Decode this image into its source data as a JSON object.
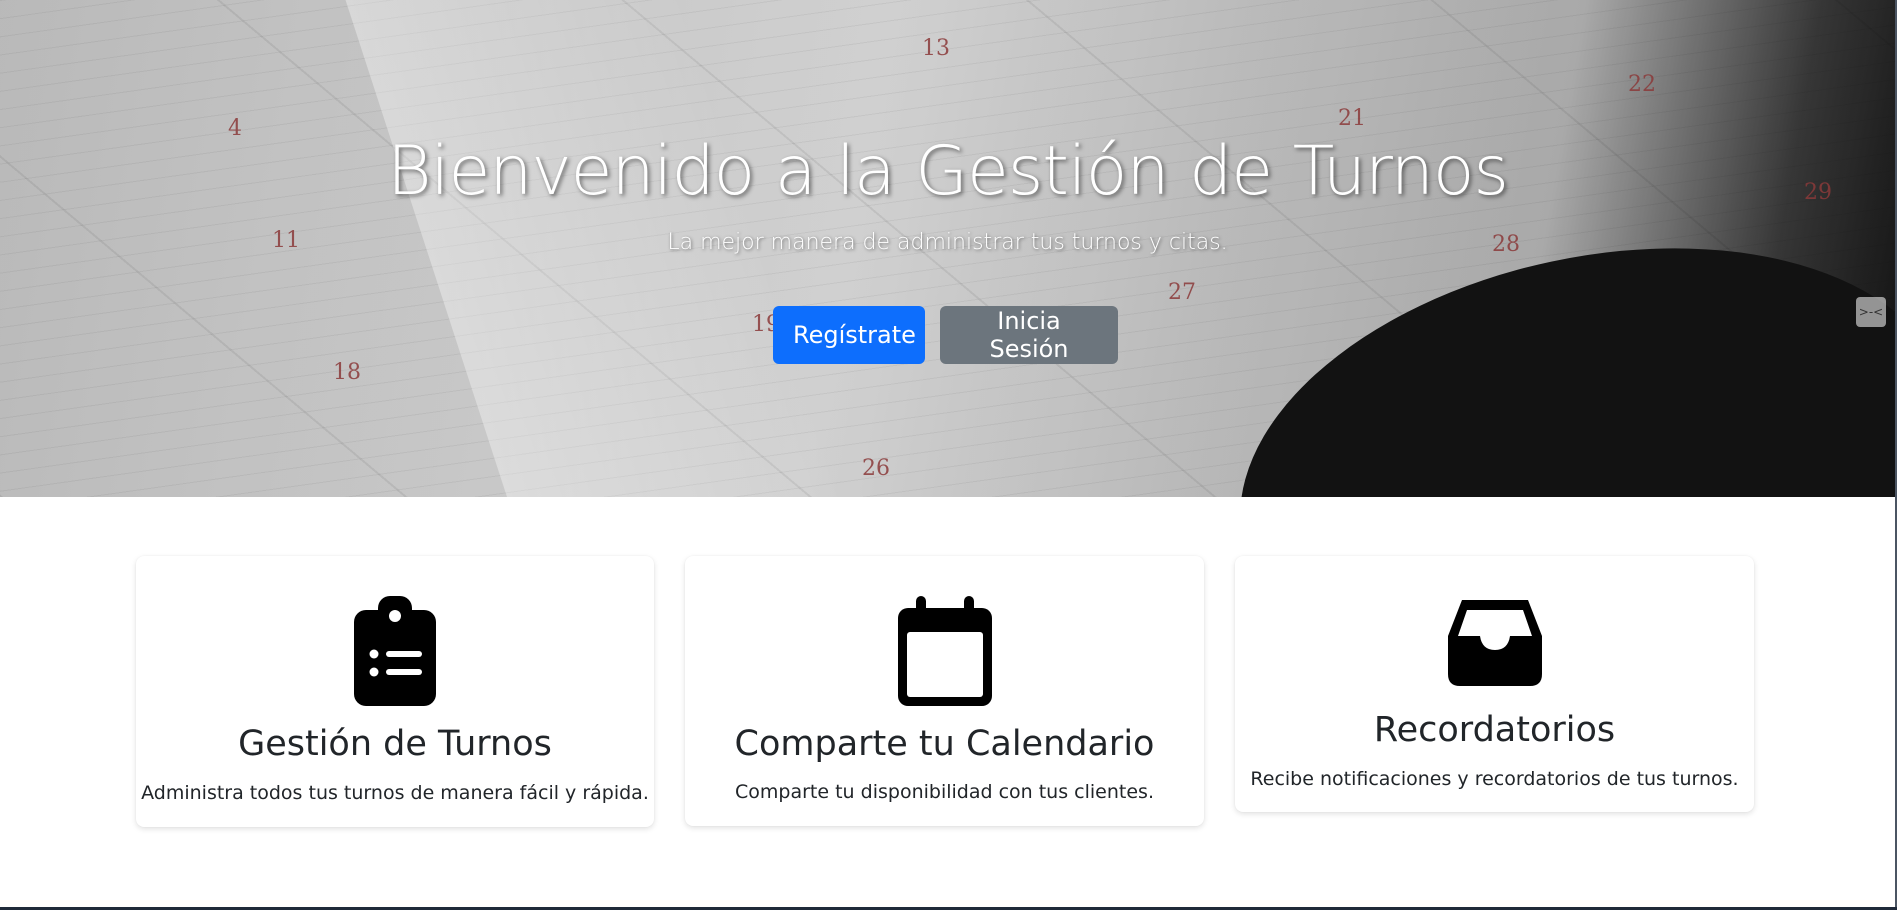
{
  "hero": {
    "title": "Bienvenido a la Gestión de Turnos",
    "subtitle": "La mejor manera de administrar tus turnos y citas.",
    "register_button": "Regístrate",
    "login_button": "Inicia Sesión",
    "calendar_numbers": [
      "4",
      "11",
      "18",
      "13",
      "21",
      "22",
      "27",
      "28",
      "29",
      "26",
      "19"
    ],
    "colors": {
      "primary": "#0d6efd",
      "secondary": "#6c757d"
    }
  },
  "features": [
    {
      "icon": "clipboard-list-icon",
      "title": "Gestión de Turnos",
      "text": "Administra todos tus turnos de manera fácil y rápida."
    },
    {
      "icon": "calendar-icon",
      "title": "Comparte tu Calendario",
      "text": "Comparte tu disponibilidad con tus clientes."
    },
    {
      "icon": "inbox-icon",
      "title": "Recordatorios",
      "text": "Recibe notificaciones y recordatorios de tus turnos."
    }
  ]
}
